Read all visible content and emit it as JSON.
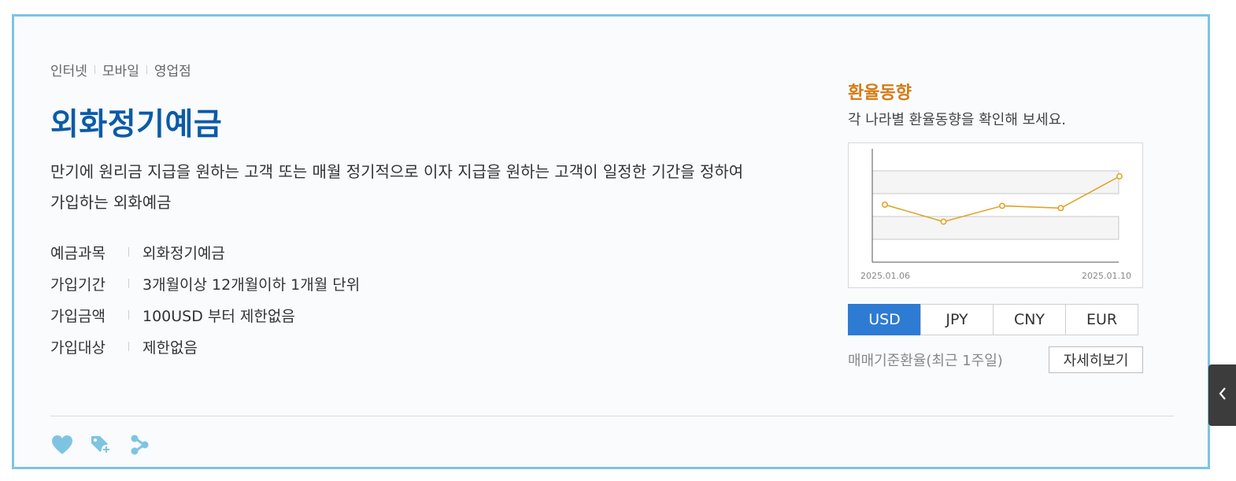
{
  "channels": [
    "인터넷",
    "모바일",
    "영업점"
  ],
  "product": {
    "title": "외화정기예금",
    "description_line1": "만기에 원리금 지급을 원하는 고객 또는 매월 정기적으로 이자 지급을 원하는 고객이 일정한 기간을 정하여",
    "description_line2": "가입하는 외화예금"
  },
  "info": [
    {
      "label": "예금과목",
      "value": "외화정기예금"
    },
    {
      "label": "가입기간",
      "value": "3개월이상 12개월이하 1개월 단위"
    },
    {
      "label": "가입금액",
      "value": "100USD 부터 제한없음"
    },
    {
      "label": "가입대상",
      "value": "제한없음"
    }
  ],
  "actions": [
    {
      "icon": "heart-icon"
    },
    {
      "icon": "tag-add-icon"
    },
    {
      "icon": "share-icon"
    }
  ],
  "exchange": {
    "title": "환율동향",
    "subtitle": "각 나라별 환율동향을 확인해 보세요.",
    "tabs": [
      "USD",
      "JPY",
      "CNY",
      "EUR"
    ],
    "active_tab": "USD",
    "note": "매매기준환율(최근 1주일)",
    "more_label": "자세히보기"
  },
  "chart_data": {
    "type": "line",
    "x_tick_labels": [
      "2025.01.06",
      "2025.01.10"
    ],
    "values": [
      0.5,
      0.2,
      0.48,
      0.44,
      1.0
    ],
    "grid": "banded",
    "line_color": "#e0a020",
    "title": "",
    "xlabel": "",
    "ylabel": ""
  },
  "colors": {
    "title": "#0b5ba8",
    "accent_orange": "#d57b13",
    "tab_active": "#2e7bd3",
    "panel_border": "#7ec4e2"
  },
  "side_toggle": {
    "icon": "chevron-left-icon"
  }
}
